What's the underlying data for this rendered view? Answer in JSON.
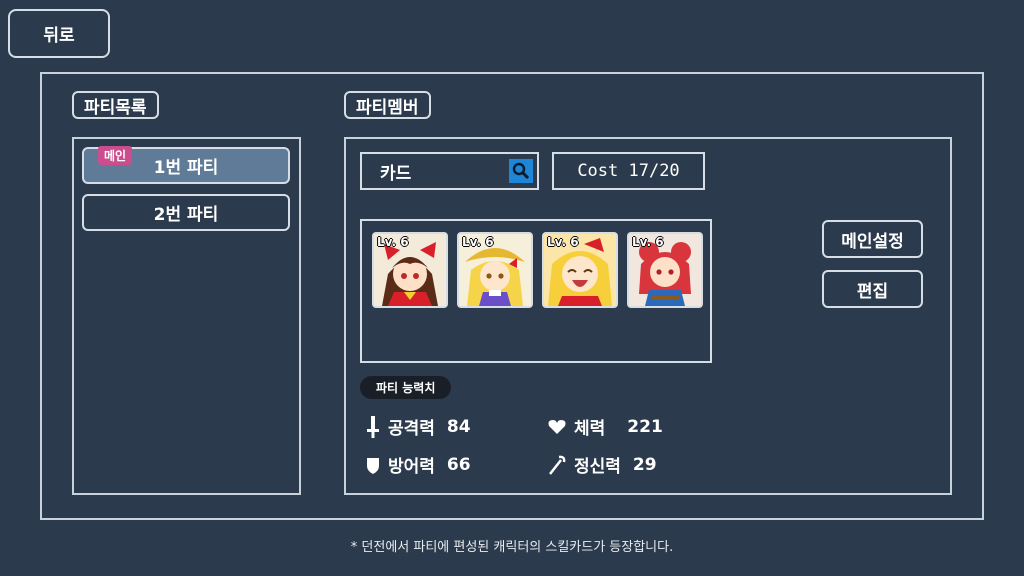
{
  "back_label": "뒤로",
  "party_list": {
    "title": "파티목록",
    "main_badge": "메인",
    "items": [
      {
        "label": "1번 파티",
        "selected": true
      },
      {
        "label": "2번 파티",
        "selected": false
      }
    ]
  },
  "party_member": {
    "title": "파티멤버",
    "search_value": "카드",
    "cost": "Cost  17/20",
    "cards": [
      {
        "level": "Lv. 6",
        "character": "red-white shrine maiden"
      },
      {
        "level": "Lv. 6",
        "character": "blonde hat girl"
      },
      {
        "level": "Lv. 6",
        "character": "laughing blonde girl"
      },
      {
        "level": "Lv. 6",
        "character": "red-haired girl"
      }
    ],
    "main_set_label": "메인설정",
    "edit_label": "편집",
    "stats_title": "파티 능력치",
    "stats": {
      "attack": {
        "label": "공격력",
        "value": "84"
      },
      "hp": {
        "label": "체력",
        "value": "221"
      },
      "defense": {
        "label": "방어력",
        "value": "66"
      },
      "mind": {
        "label": "정신력",
        "value": "29"
      }
    }
  },
  "footer_note": "* 던전에서 파티에 편성된 캐릭터의 스킬카드가 등장합니다.",
  "colors": {
    "background": "#2b3a4c",
    "selected_party": "#5f7b98",
    "badge": "#cc4d8e",
    "search_button": "#1e86d6"
  }
}
